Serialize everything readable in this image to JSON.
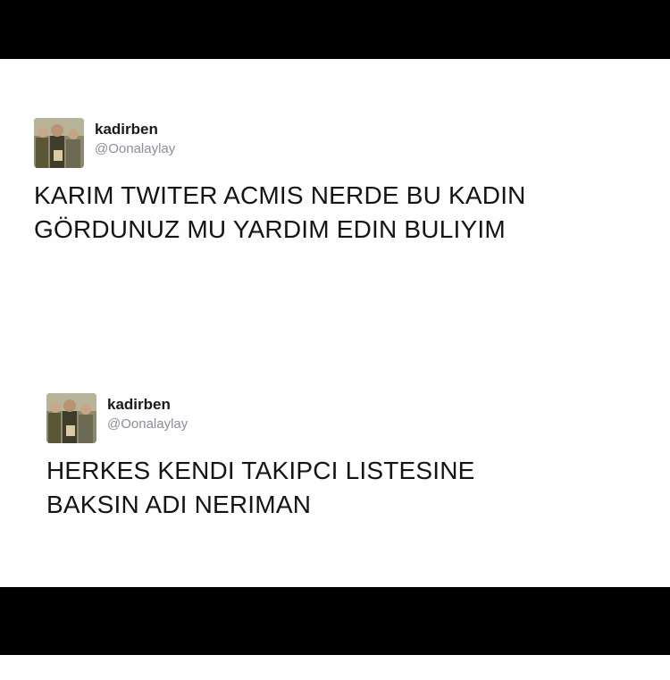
{
  "tweets": [
    {
      "display_name": "kadirben",
      "handle": "@Oonalaylay",
      "text_lines": [
        "KARIM TWITER ACMIS NERDE BU KADIN",
        "GÖRDUNUZ MU YARDIM EDIN BULIYIM"
      ]
    },
    {
      "display_name": "kadirben",
      "handle": "@Oonalaylay",
      "text_lines": [
        "HERKES KENDI TAKIPCI LISTESINE",
        "BAKSIN ADI NERIMAN"
      ]
    }
  ]
}
